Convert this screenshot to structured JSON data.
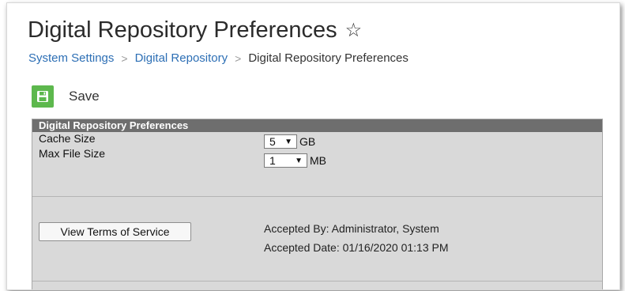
{
  "page": {
    "title": "Digital Repository Preferences"
  },
  "breadcrumb": {
    "items": [
      "System Settings",
      "Digital Repository",
      "Digital Repository Preferences"
    ],
    "separator": ">"
  },
  "toolbar": {
    "save_label": "Save"
  },
  "panel": {
    "header": "Digital Repository Preferences",
    "cache_size": {
      "label": "Cache Size",
      "value": "5",
      "unit": "GB"
    },
    "max_file_size": {
      "label": "Max File Size",
      "value": "1",
      "unit": "MB"
    },
    "terms_button_label": "View Terms of Service",
    "accepted_by": "Accepted By: Administrator, System",
    "accepted_date": "Accepted Date: 01/16/2020 01:13 PM"
  },
  "colors": {
    "link": "#2d6fb5",
    "save_icon": "#5db84d",
    "panel_header": "#6e6e6e",
    "panel_body": "#d9d9d9"
  },
  "icons": {
    "favorite": "star-outline-icon",
    "save": "floppy-disk-icon",
    "dropdown": "caret-down-icon"
  }
}
